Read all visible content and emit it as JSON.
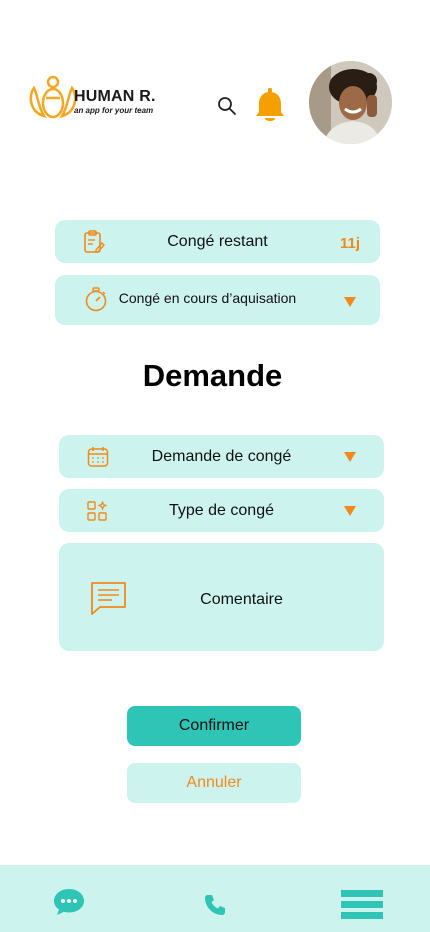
{
  "brand": {
    "name": "HUMAN R.",
    "tagline": "an app for your team"
  },
  "header": {
    "search_icon": "search-icon",
    "notification_icon": "bell-icon",
    "avatar": "user-avatar"
  },
  "leave_balance": {
    "label": "Congé restant",
    "value": "11j"
  },
  "leave_accrual": {
    "label": "Congé en cours d’aquisation"
  },
  "page_title": "Demande",
  "form": {
    "request_label": "Demande de congé",
    "type_label": "Type de congé",
    "comment_label": "Comentaire"
  },
  "actions": {
    "confirm": "Confirmer",
    "cancel": "Annuler"
  },
  "colors": {
    "accent": "#2ec4b6",
    "light_accent": "#cdf3ee",
    "orange": "#f08a1c"
  }
}
